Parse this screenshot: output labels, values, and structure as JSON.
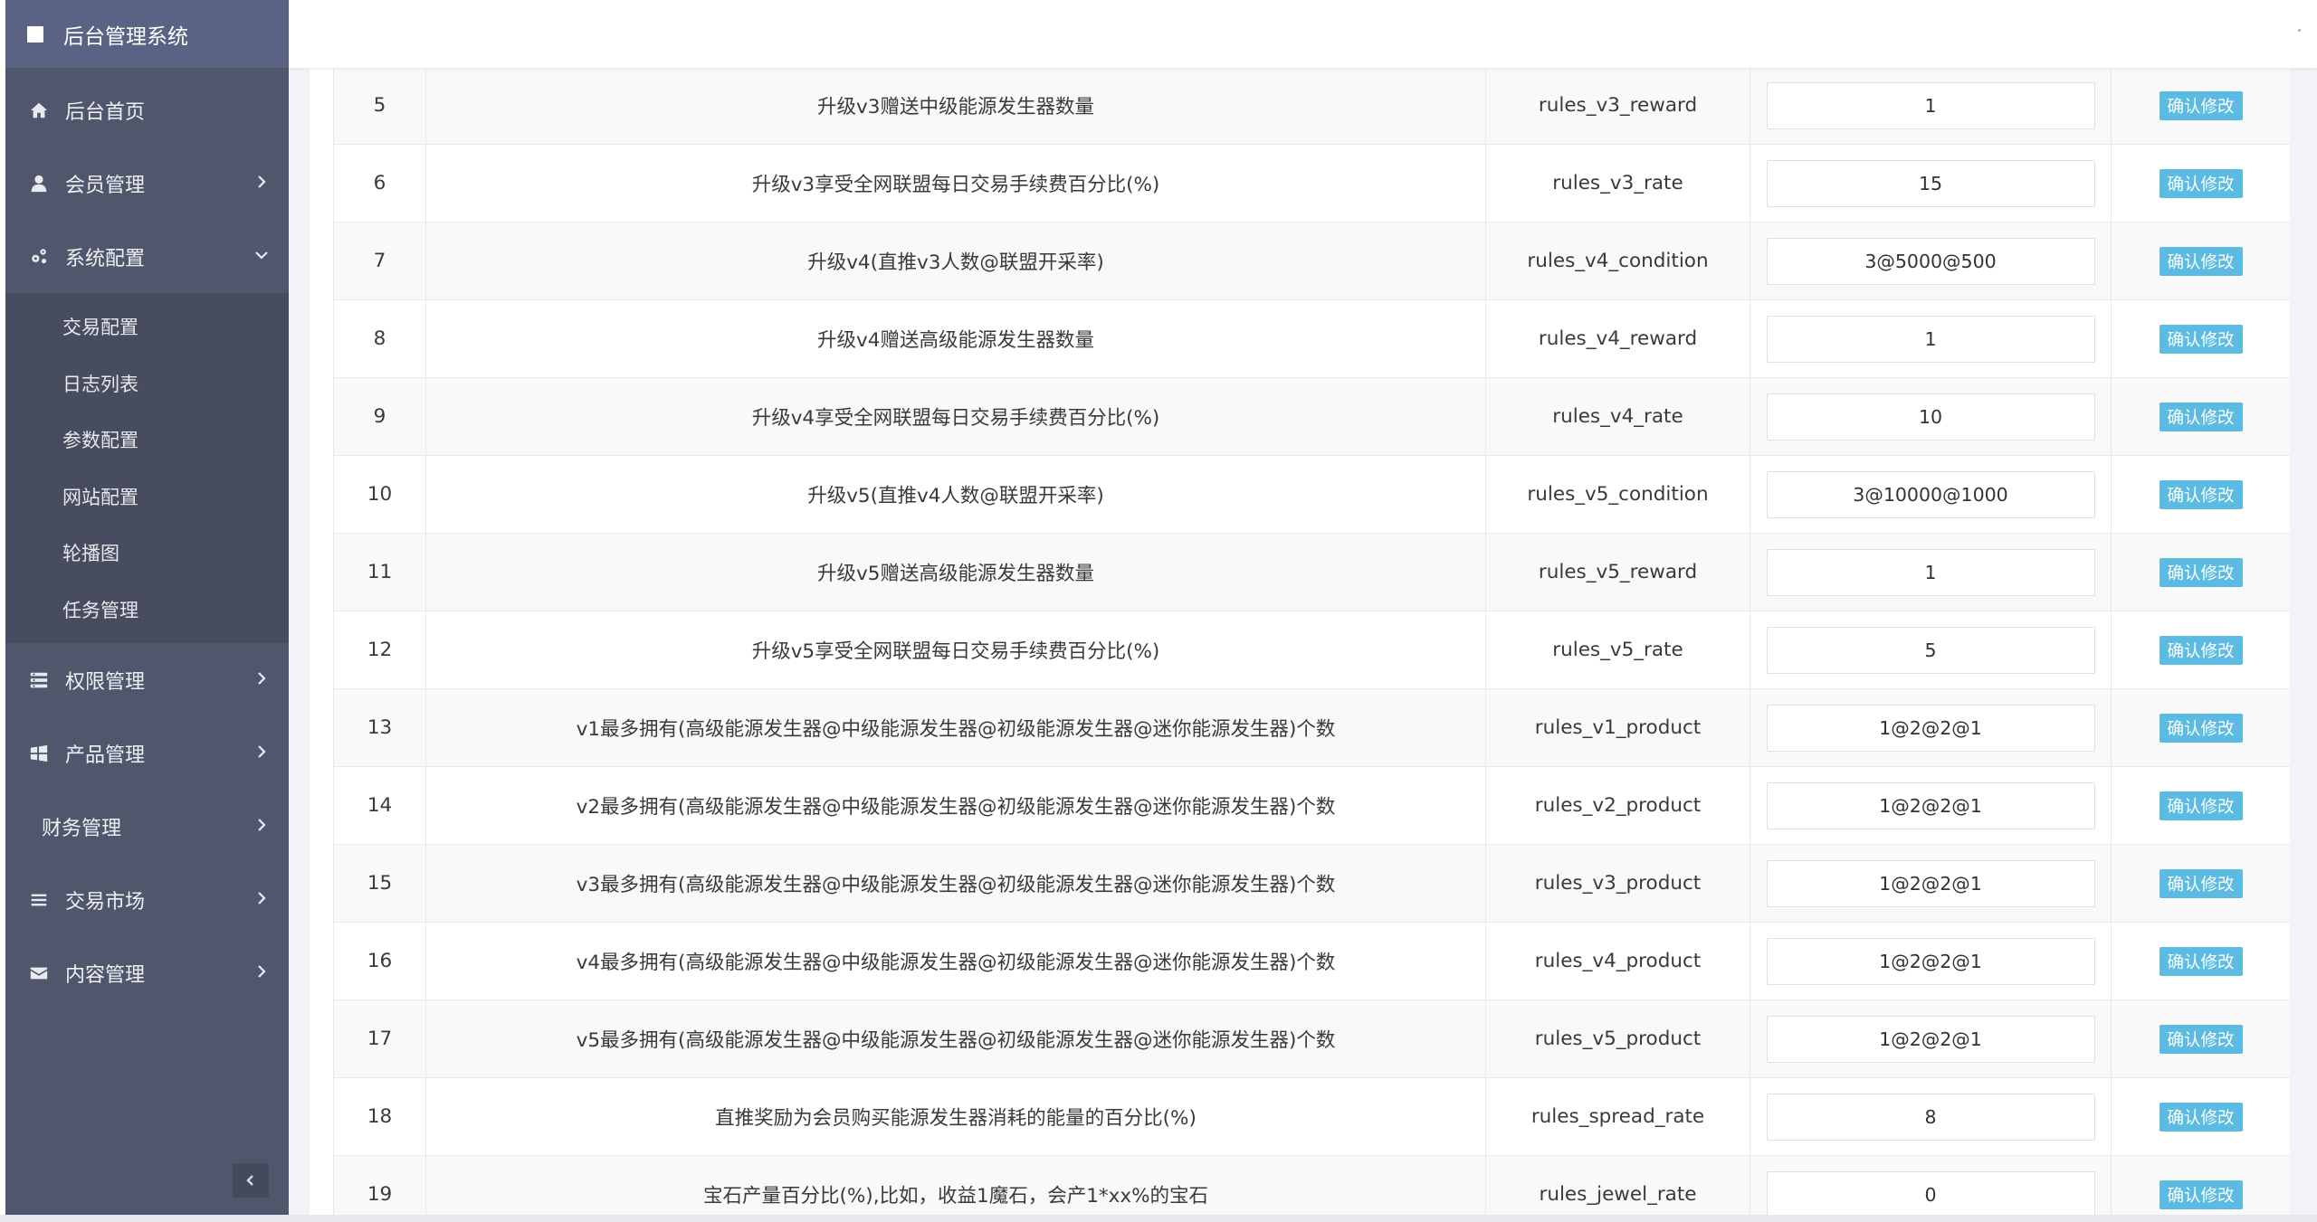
{
  "brand": {
    "title": "后台管理系统"
  },
  "sidebar": {
    "items": [
      {
        "label": "后台首页",
        "icon": "home-icon"
      },
      {
        "label": "会员管理",
        "icon": "user-icon"
      },
      {
        "label": "系统配置",
        "icon": "gears-icon",
        "expanded": true
      },
      {
        "label": "权限管理",
        "icon": "list-icon"
      },
      {
        "label": "产品管理",
        "icon": "windows-icon"
      },
      {
        "label": "财务管理",
        "icon": ""
      },
      {
        "label": "交易市场",
        "icon": "bars-icon"
      },
      {
        "label": "内容管理",
        "icon": "envelope-icon"
      }
    ],
    "submenu": [
      {
        "label": "交易配置"
      },
      {
        "label": "日志列表"
      },
      {
        "label": "参数配置"
      },
      {
        "label": "网站配置"
      },
      {
        "label": "轮播图"
      },
      {
        "label": "任务管理"
      }
    ]
  },
  "table": {
    "rows": [
      {
        "idx": "5",
        "desc": "升级v3赠送中级能源发生器数量",
        "key": "rules_v3_reward",
        "value": "1",
        "action": "确认修改"
      },
      {
        "idx": "6",
        "desc": "升级v3享受全网联盟每日交易手续费百分比(%)",
        "key": "rules_v3_rate",
        "value": "15",
        "action": "确认修改"
      },
      {
        "idx": "7",
        "desc": "升级v4(直推v3人数@联盟开采率)",
        "key": "rules_v4_condition",
        "value": "3@5000@500",
        "action": "确认修改"
      },
      {
        "idx": "8",
        "desc": "升级v4赠送高级能源发生器数量",
        "key": "rules_v4_reward",
        "value": "1",
        "action": "确认修改"
      },
      {
        "idx": "9",
        "desc": "升级v4享受全网联盟每日交易手续费百分比(%)",
        "key": "rules_v4_rate",
        "value": "10",
        "action": "确认修改"
      },
      {
        "idx": "10",
        "desc": "升级v5(直推v4人数@联盟开采率)",
        "key": "rules_v5_condition",
        "value": "3@10000@1000",
        "action": "确认修改"
      },
      {
        "idx": "11",
        "desc": "升级v5赠送高级能源发生器数量",
        "key": "rules_v5_reward",
        "value": "1",
        "action": "确认修改"
      },
      {
        "idx": "12",
        "desc": "升级v5享受全网联盟每日交易手续费百分比(%)",
        "key": "rules_v5_rate",
        "value": "5",
        "action": "确认修改"
      },
      {
        "idx": "13",
        "desc": "v1最多拥有(高级能源发生器@中级能源发生器@初级能源发生器@迷你能源发生器)个数",
        "key": "rules_v1_product",
        "value": "1@2@2@1",
        "action": "确认修改"
      },
      {
        "idx": "14",
        "desc": "v2最多拥有(高级能源发生器@中级能源发生器@初级能源发生器@迷你能源发生器)个数",
        "key": "rules_v2_product",
        "value": "1@2@2@1",
        "action": "确认修改"
      },
      {
        "idx": "15",
        "desc": "v3最多拥有(高级能源发生器@中级能源发生器@初级能源发生器@迷你能源发生器)个数",
        "key": "rules_v3_product",
        "value": "1@2@2@1",
        "action": "确认修改"
      },
      {
        "idx": "16",
        "desc": "v4最多拥有(高级能源发生器@中级能源发生器@初级能源发生器@迷你能源发生器)个数",
        "key": "rules_v4_product",
        "value": "1@2@2@1",
        "action": "确认修改"
      },
      {
        "idx": "17",
        "desc": "v5最多拥有(高级能源发生器@中级能源发生器@初级能源发生器@迷你能源发生器)个数",
        "key": "rules_v5_product",
        "value": "1@2@2@1",
        "action": "确认修改"
      },
      {
        "idx": "18",
        "desc": "直推奖励为会员购买能源发生器消耗的能量的百分比(%)",
        "key": "rules_spread_rate",
        "value": "8",
        "action": "确认修改"
      },
      {
        "idx": "19",
        "desc": "宝石产量百分比(%),比如，收益1魔石，会产1*xx%的宝石",
        "key": "rules_jewel_rate",
        "value": "0",
        "action": "确认修改"
      }
    ]
  },
  "colors": {
    "sidebar_bg": "#50576c",
    "brand_bg": "#5a6384",
    "submenu_bg": "#474d5f",
    "button_bg": "#5bbbe3"
  }
}
